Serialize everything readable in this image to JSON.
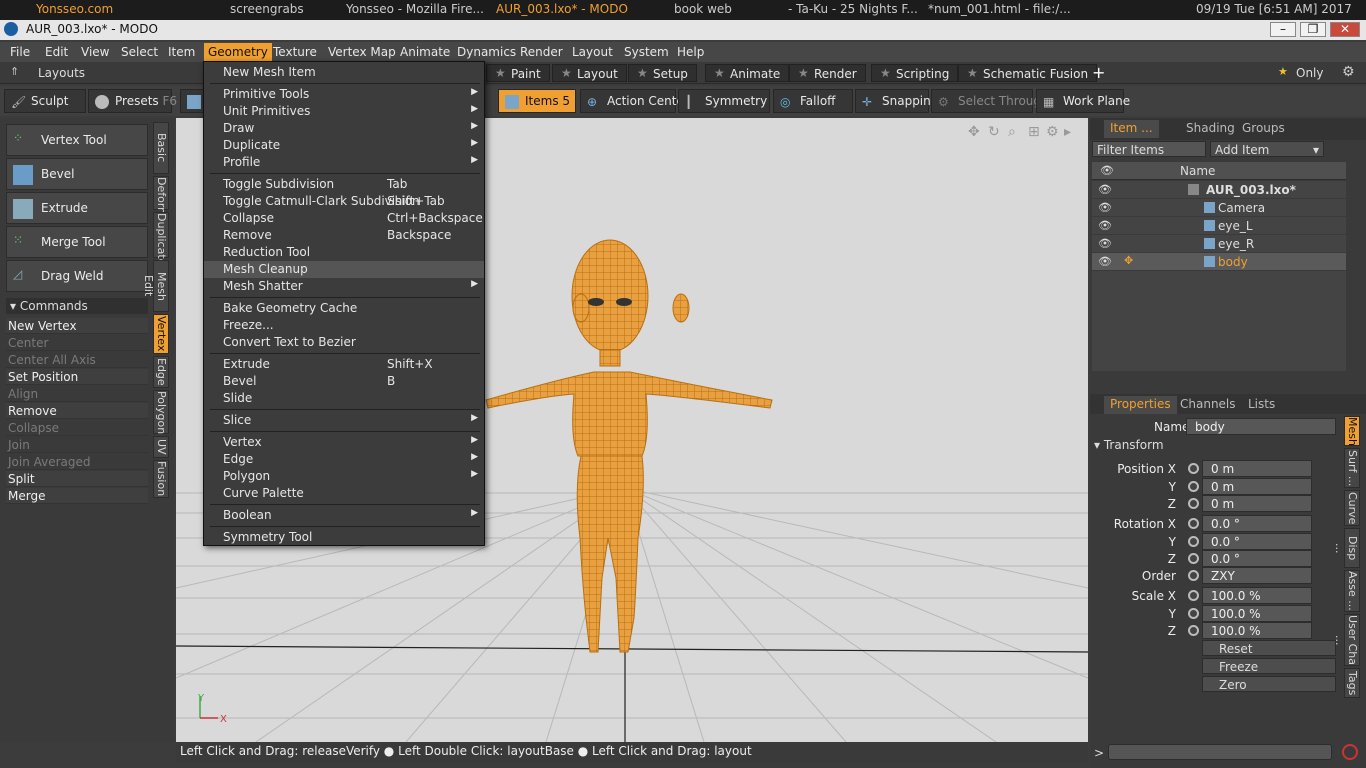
{
  "taskbar": {
    "items": [
      "Yonsseo.com",
      "screengrabs",
      "Yonsseo - Mozilla Fire...",
      "AUR_003.lxo* - MODO",
      "book web",
      "- Ta-Ku - 25 Nights F...",
      "*num_001.html - file:/...",
      "09/19 Tue [6:51 AM] 2017"
    ]
  },
  "title": "AUR_003.lxo* - MODO",
  "menus": [
    "File",
    "Edit",
    "View",
    "Select",
    "Item",
    "Geometry",
    "Texture",
    "Vertex Map",
    "Animate",
    "Dynamics",
    "Render",
    "Layout",
    "System",
    "Help"
  ],
  "layoutbar": {
    "layouts_label": "Layouts",
    "tabs": [
      "Paint",
      "Layout",
      "Setup",
      "Animate",
      "Render",
      "Scripting",
      "Schematic Fusion"
    ],
    "add": "+",
    "only": "Only"
  },
  "toolbar": {
    "sculpt": "Sculpt",
    "presets": "Presets",
    "presets_key": "F6",
    "items": "Items",
    "items_key": "5",
    "action_center": "Action Center",
    "symmetry": "Symmetry",
    "falloff": "Falloff",
    "snapping": "Snapping",
    "select_through": "Select Through",
    "work_plane": "Work Plane"
  },
  "left_tools": [
    "Vertex Tool",
    "Bevel",
    "Extrude",
    "Merge Tool",
    "Drag Weld"
  ],
  "commands_label": "Commands",
  "commands": [
    {
      "label": "New Vertex",
      "enabled": true
    },
    {
      "label": "Center",
      "enabled": false
    },
    {
      "label": "Center All Axis",
      "enabled": false
    },
    {
      "label": "Set Position",
      "enabled": true
    },
    {
      "label": "Align",
      "enabled": false
    },
    {
      "label": "Remove",
      "enabled": true
    },
    {
      "label": "Collapse",
      "enabled": false
    },
    {
      "label": "Join",
      "enabled": false
    },
    {
      "label": "Join Averaged",
      "enabled": false
    },
    {
      "label": "Split",
      "enabled": true
    },
    {
      "label": "Merge",
      "enabled": true
    }
  ],
  "vtabs": [
    "Basic",
    "Deform",
    "Duplicate",
    "Mesh Edit",
    "Vertex",
    "Edge",
    "Polygon",
    "UV",
    "Fusion"
  ],
  "geometry_menu": [
    {
      "label": "New Mesh Item",
      "shortcut": "",
      "sub": false
    },
    {
      "sep": true
    },
    {
      "label": "Primitive Tools",
      "shortcut": "",
      "sub": true
    },
    {
      "label": "Unit Primitives",
      "shortcut": "",
      "sub": true
    },
    {
      "label": "Draw",
      "shortcut": "",
      "sub": true
    },
    {
      "label": "Duplicate",
      "shortcut": "",
      "sub": true
    },
    {
      "label": "Profile",
      "shortcut": "",
      "sub": true
    },
    {
      "sep": true
    },
    {
      "label": "Toggle Subdivision",
      "shortcut": "Tab",
      "sub": false
    },
    {
      "label": "Toggle Catmull-Clark Subdivision",
      "shortcut": "Shift+Tab",
      "sub": false
    },
    {
      "label": "Collapse",
      "shortcut": "Ctrl+Backspace",
      "sub": false
    },
    {
      "label": "Remove",
      "shortcut": "Backspace",
      "sub": false
    },
    {
      "label": "Reduction Tool",
      "shortcut": "",
      "sub": false
    },
    {
      "label": "Mesh Cleanup",
      "shortcut": "",
      "sub": false,
      "hl": true
    },
    {
      "label": "Mesh Shatter",
      "shortcut": "",
      "sub": true
    },
    {
      "sep": true
    },
    {
      "label": "Bake Geometry Cache",
      "shortcut": "",
      "sub": false
    },
    {
      "label": "Freeze...",
      "shortcut": "",
      "sub": false
    },
    {
      "label": "Convert Text to Bezier",
      "shortcut": "",
      "sub": false
    },
    {
      "sep": true
    },
    {
      "label": "Extrude",
      "shortcut": "Shift+X",
      "sub": false
    },
    {
      "label": "Bevel",
      "shortcut": "B",
      "sub": false
    },
    {
      "label": "Slide",
      "shortcut": "",
      "sub": false
    },
    {
      "sep": true
    },
    {
      "label": "Slice",
      "shortcut": "",
      "sub": true
    },
    {
      "sep": true
    },
    {
      "label": "Vertex",
      "shortcut": "",
      "sub": true
    },
    {
      "label": "Edge",
      "shortcut": "",
      "sub": true
    },
    {
      "label": "Polygon",
      "shortcut": "",
      "sub": true
    },
    {
      "label": "Curve Palette",
      "shortcut": "",
      "sub": false
    },
    {
      "sep": true
    },
    {
      "label": "Boolean",
      "shortcut": "",
      "sub": true
    },
    {
      "sep": true
    },
    {
      "label": "Symmetry Tool",
      "shortcut": "",
      "sub": false
    }
  ],
  "item_panel": {
    "tabs": [
      "Item ...",
      "Shading",
      "Groups"
    ],
    "filter_placeholder": "Filter Items",
    "add_item": "Add Item",
    "col_name": "Name",
    "items": [
      {
        "name": "AUR_003.lxo*",
        "indent": 0,
        "bold": true
      },
      {
        "name": "Camera",
        "indent": 1
      },
      {
        "name": "eye_L",
        "indent": 1
      },
      {
        "name": "eye_R",
        "indent": 1
      },
      {
        "name": "body",
        "indent": 1,
        "selected": true
      }
    ]
  },
  "properties": {
    "tabs": [
      "Properties",
      "Channels",
      "Lists"
    ],
    "name_label": "Name",
    "name_value": "body",
    "section": "Transform",
    "rows": [
      {
        "label": "Position X",
        "value": "0 m"
      },
      {
        "label": "Y",
        "value": "0 m"
      },
      {
        "label": "Z",
        "value": "0 m"
      },
      {
        "label": "Rotation X",
        "value": "0.0 °"
      },
      {
        "label": "Y",
        "value": "0.0 °"
      },
      {
        "label": "Z",
        "value": "0.0 °"
      },
      {
        "label": "Order",
        "value": "ZXY"
      },
      {
        "label": "Scale X",
        "value": "100.0 %"
      },
      {
        "label": "Y",
        "value": "100.0 %"
      },
      {
        "label": "Z",
        "value": "100.0 %"
      }
    ],
    "buttons": [
      "Reset",
      "Freeze",
      "Zero"
    ],
    "side_tabs": [
      "Mesh",
      "Surf ...",
      "Curve",
      "Disp ...",
      "Asse ...",
      "User Cha ...",
      "Tags"
    ]
  },
  "status": "Left Click and Drag: releaseVerify ● Left Double Click: layoutBase ● Left Click and Drag: layout",
  "axis": {
    "x": "X",
    "y": "Y"
  },
  "cmd_prompt": ">"
}
